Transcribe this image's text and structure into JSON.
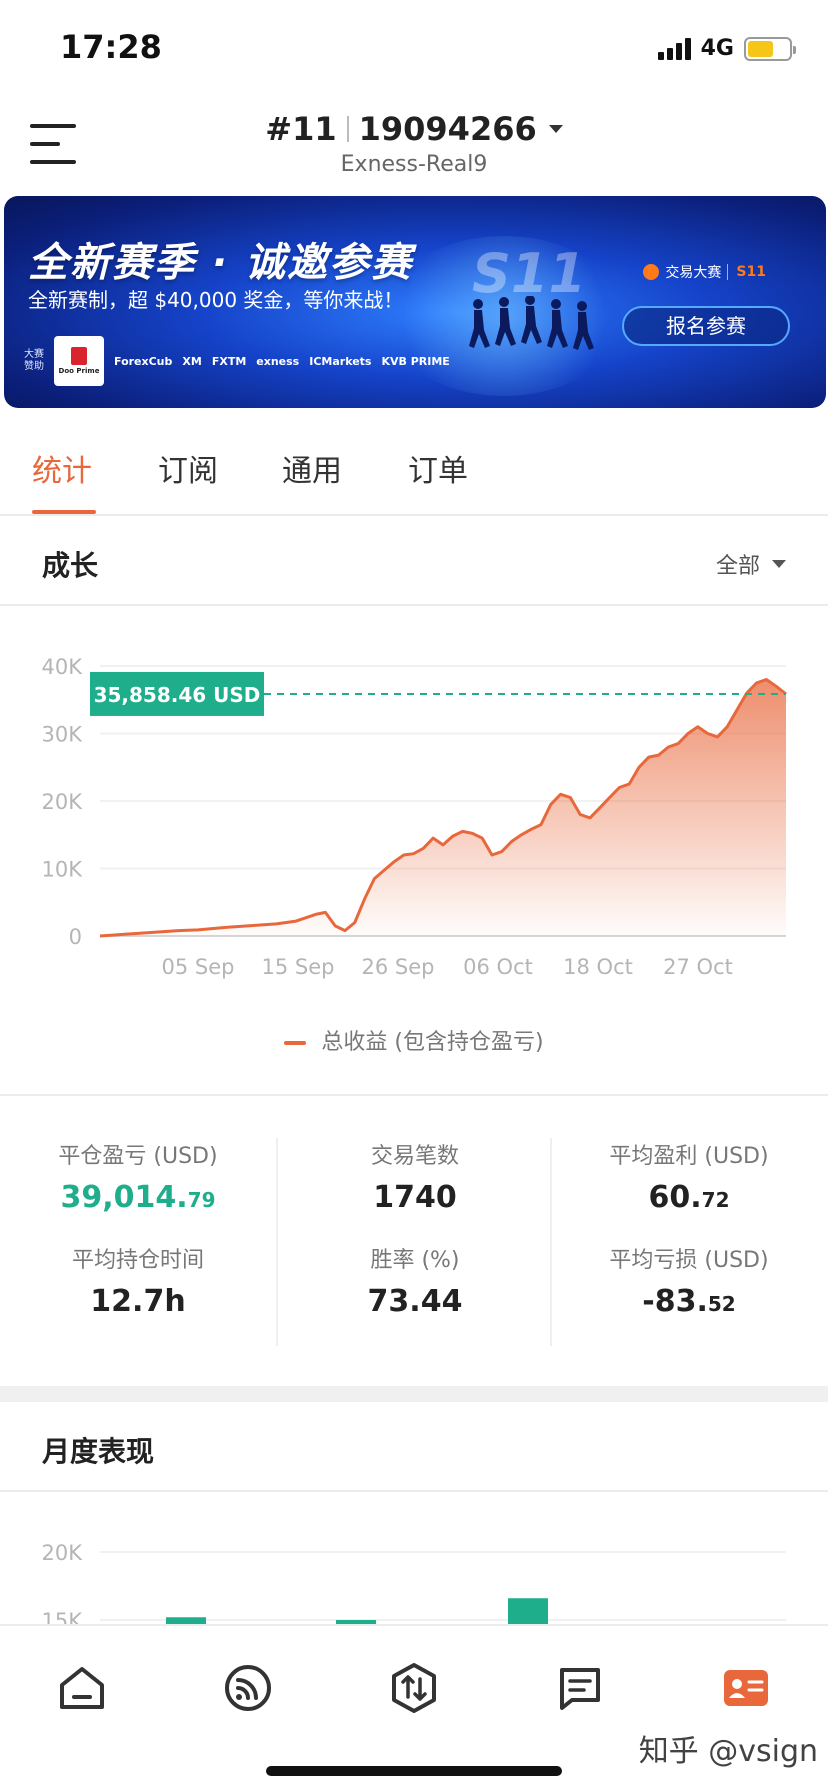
{
  "status": {
    "time": "17:28",
    "network": "4G"
  },
  "header": {
    "rank": "#11",
    "account_id": "19094266",
    "server": "Exness-Real9"
  },
  "banner": {
    "title": "全新赛季 · 诚邀参赛",
    "subtitle": "全新赛制，超 $40,000 奖金，等你来战！",
    "season": "S11",
    "brand": "交易大赛",
    "brand_season": "S11",
    "join_label": "报名参赛",
    "sponsor_label": "大赛赞助",
    "sponsors": [
      "Doo Prime",
      "ForexCub",
      "XM",
      "FXTM",
      "exness",
      "ICMarkets",
      "KVB PRIME"
    ]
  },
  "tabs": [
    {
      "label": "统计",
      "active": true
    },
    {
      "label": "订阅",
      "active": false
    },
    {
      "label": "通用",
      "active": false
    },
    {
      "label": "订单",
      "active": false
    }
  ],
  "growth": {
    "title": "成长",
    "range": "全部",
    "legend": "总收益 (包含持仓盈亏)",
    "current_value_label": "35,858.46 USD"
  },
  "chart_data": [
    {
      "type": "area",
      "title": "成长",
      "xlabel": "",
      "ylabel": "",
      "x_ticks": [
        "05 Sep",
        "15 Sep",
        "26 Sep",
        "06 Oct",
        "18 Oct",
        "27 Oct"
      ],
      "y_ticks": [
        "0",
        "10K",
        "20K",
        "30K",
        "40K"
      ],
      "ylim": [
        0,
        40000
      ],
      "grid": true,
      "legend_position": "bottom",
      "series": [
        {
          "name": "总收益 (包含持仓盈亏)",
          "color": "#e8683c",
          "points": [
            [
              0,
              0
            ],
            [
              2,
              200
            ],
            [
              5,
              500
            ],
            [
              8,
              800
            ],
            [
              10,
              900
            ],
            [
              13,
              1300
            ],
            [
              16,
              1600
            ],
            [
              18,
              1800
            ],
            [
              20,
              2200
            ],
            [
              22,
              3200
            ],
            [
              23,
              3500
            ],
            [
              24,
              1500
            ],
            [
              25,
              800
            ],
            [
              26,
              2000
            ],
            [
              27,
              5500
            ],
            [
              28,
              8500
            ],
            [
              30,
              11000
            ],
            [
              31,
              12000
            ],
            [
              32,
              12200
            ],
            [
              33,
              13000
            ],
            [
              34,
              14500
            ],
            [
              35,
              13500
            ],
            [
              36,
              14800
            ],
            [
              37,
              15500
            ],
            [
              38,
              15200
            ],
            [
              39,
              14500
            ],
            [
              40,
              12000
            ],
            [
              41,
              12500
            ],
            [
              42,
              14000
            ],
            [
              43,
              15000
            ],
            [
              44,
              15800
            ],
            [
              45,
              16500
            ],
            [
              46,
              19500
            ],
            [
              47,
              21000
            ],
            [
              48,
              20500
            ],
            [
              49,
              18000
            ],
            [
              50,
              17500
            ],
            [
              51,
              19000
            ],
            [
              52,
              20500
            ],
            [
              53,
              22000
            ],
            [
              54,
              22500
            ],
            [
              55,
              25000
            ],
            [
              56,
              26500
            ],
            [
              57,
              26800
            ],
            [
              58,
              28000
            ],
            [
              59,
              28500
            ],
            [
              60,
              30000
            ],
            [
              61,
              31000
            ],
            [
              62,
              30000
            ],
            [
              63,
              29500
            ],
            [
              64,
              31000
            ],
            [
              65,
              33500
            ],
            [
              66,
              36000
            ],
            [
              67,
              37500
            ],
            [
              68,
              38000
            ],
            [
              69,
              37000
            ],
            [
              70,
              35858
            ]
          ],
          "last_value": 35858.46
        }
      ]
    },
    {
      "type": "bar",
      "title": "月度表现",
      "y_ticks": [
        "20K",
        "15K"
      ],
      "ylim": [
        0,
        20000
      ],
      "categories": [
        "",
        "",
        ""
      ],
      "series": [
        {
          "color": "#1fae8b",
          "values": [
            15200,
            15000,
            16600
          ]
        }
      ]
    }
  ],
  "stats": [
    {
      "label": "平仓盈亏 (USD)",
      "value_main": "39,014.",
      "value_dec": "79",
      "green": true
    },
    {
      "label": "交易笔数",
      "value_main": "1740",
      "value_dec": "",
      "green": false
    },
    {
      "label": "平均盈利 (USD)",
      "value_main": "60.",
      "value_dec": "72",
      "green": false
    },
    {
      "label": "平均持仓时间",
      "value_main": "12.7h",
      "value_dec": "",
      "green": false
    },
    {
      "label": "胜率 (%)",
      "value_main": "73.44",
      "value_dec": "",
      "green": false
    },
    {
      "label": "平均亏损 (USD)",
      "value_main": "-83.",
      "value_dec": "52",
      "green": false
    }
  ],
  "monthly": {
    "title": "月度表现"
  },
  "bottom_nav": [
    {
      "icon": "home-icon"
    },
    {
      "icon": "signal-feed-icon"
    },
    {
      "icon": "trade-icon"
    },
    {
      "icon": "message-icon"
    },
    {
      "icon": "profile-card-icon",
      "active": true
    }
  ],
  "watermark": "知乎 @vsign",
  "colors": {
    "accent": "#e8683c",
    "green": "#1fae8b",
    "divider": "#ececec"
  }
}
